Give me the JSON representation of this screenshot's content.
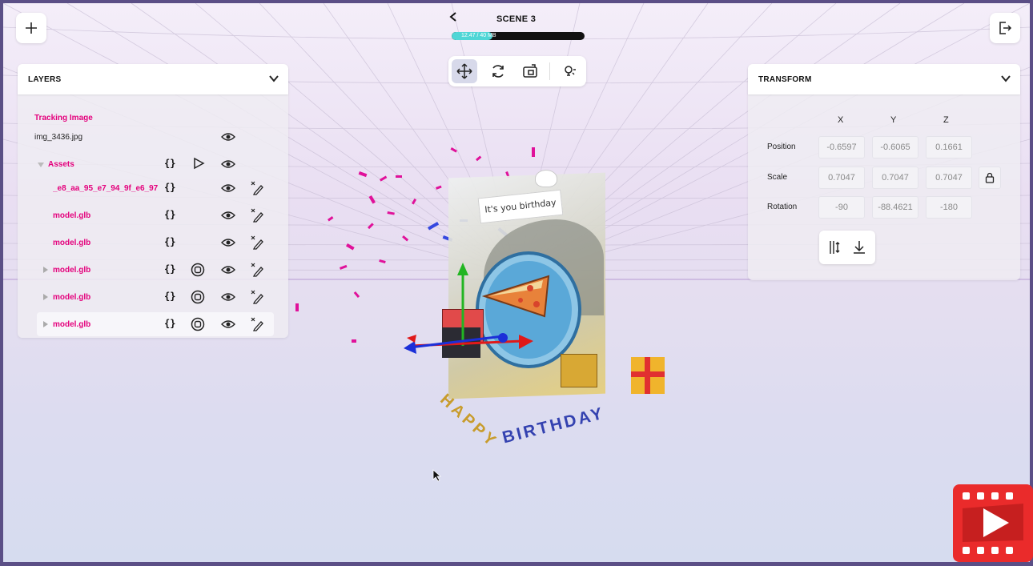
{
  "header": {
    "scene_title": "SCENE 3",
    "memory_text": "12.47 / 40 MB",
    "memory_fraction": 0.31
  },
  "toolbar": {
    "tools": [
      "move-icon",
      "rotate-icon",
      "scale-icon",
      "light-icon"
    ],
    "active_tool": "move-icon"
  },
  "top_buttons": {
    "add": "plus-icon",
    "exit": "exit-icon"
  },
  "layers": {
    "title": "LAYERS",
    "tracking_label": "Tracking Image",
    "tracking_file": "img_3436.jpg",
    "assets_label": "Assets",
    "items": [
      {
        "name": "_e8_aa_95_e7_94_9f_e6_97",
        "has_play": false,
        "has_expand": false
      },
      {
        "name": "model.glb",
        "has_play": false,
        "has_expand": false
      },
      {
        "name": "model.glb",
        "has_play": false,
        "has_expand": false
      },
      {
        "name": "model.glb",
        "has_play": true,
        "has_expand": true
      },
      {
        "name": "model.glb",
        "has_play": true,
        "has_expand": true
      },
      {
        "name": "model.glb",
        "has_play": true,
        "has_expand": true
      }
    ]
  },
  "transform": {
    "title": "TRANSFORM",
    "axes": [
      "X",
      "Y",
      "Z"
    ],
    "rows": [
      {
        "label": "Position",
        "values": [
          "-0.6597",
          "-0.6065",
          "0.1661"
        ]
      },
      {
        "label": "Scale",
        "values": [
          "0.7047",
          "0.7047",
          "0.7047"
        ]
      },
      {
        "label": "Rotation",
        "values": [
          "-90",
          "-88.4621",
          "-180"
        ]
      }
    ]
  },
  "scene": {
    "banner_text": "It's you birthday",
    "happy_text": "HAPPY",
    "birthday_text": "BIRTHDAY"
  },
  "colors": {
    "accent_pink": "#e4007c",
    "mem_fill": "#4fd6d6",
    "axis_x": "#e01919",
    "axis_y": "#22b522",
    "axis_z": "#1b2fd8"
  }
}
